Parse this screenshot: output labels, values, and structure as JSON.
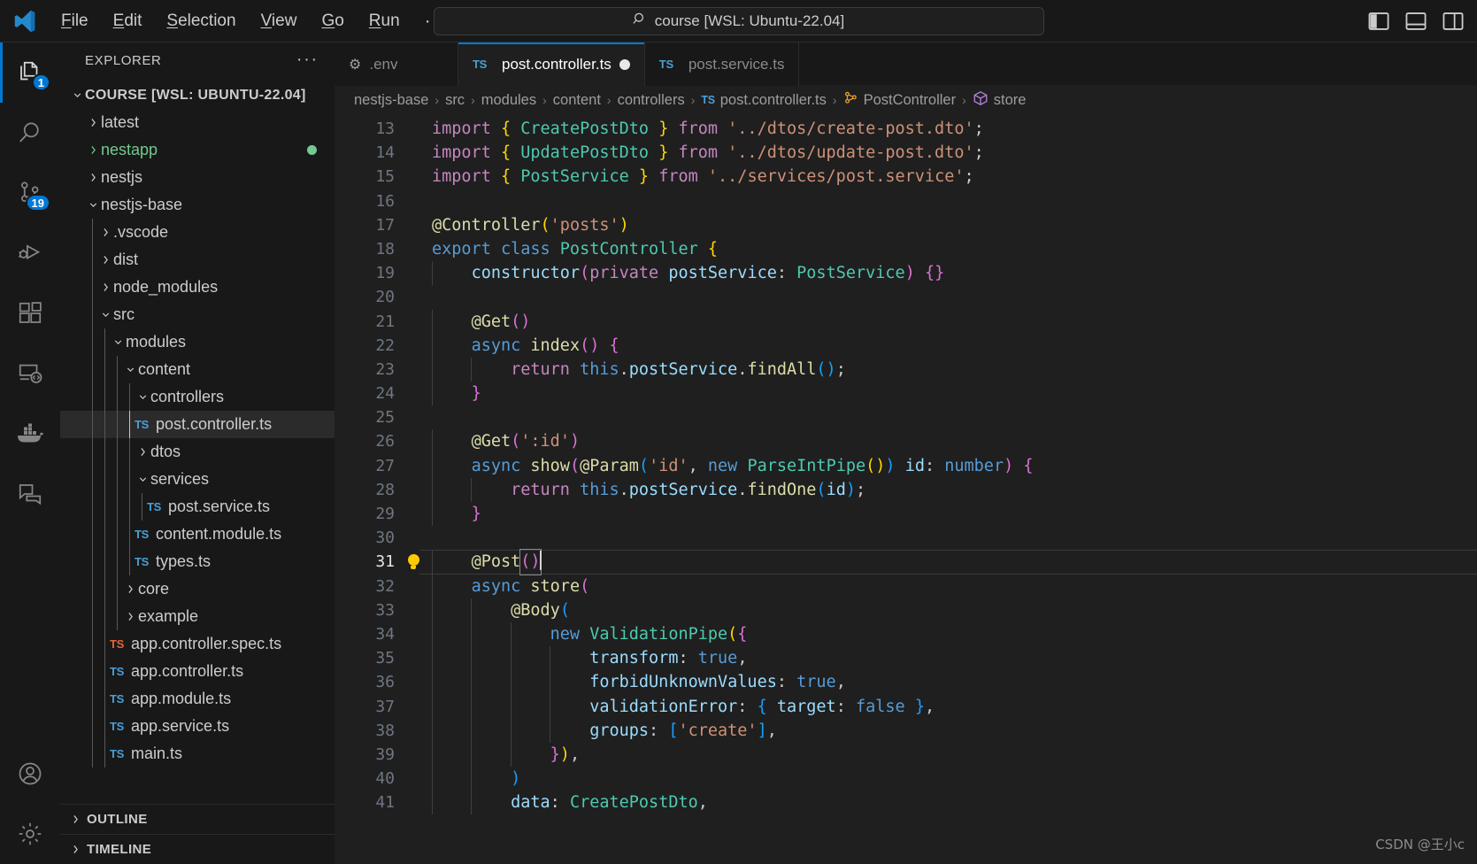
{
  "titlebar": {
    "logo_icon": "vscode-logo-icon",
    "menu": [
      {
        "pre": "",
        "mnemonic": "F",
        "post": "ile",
        "name": "menu-file"
      },
      {
        "pre": "",
        "mnemonic": "E",
        "post": "dit",
        "name": "menu-edit"
      },
      {
        "pre": "",
        "mnemonic": "S",
        "post": "election",
        "name": "menu-selection"
      },
      {
        "pre": "",
        "mnemonic": "V",
        "post": "iew",
        "name": "menu-view"
      },
      {
        "pre": "",
        "mnemonic": "G",
        "post": "o",
        "name": "menu-go"
      },
      {
        "pre": "",
        "mnemonic": "R",
        "post": "un",
        "name": "menu-run"
      }
    ],
    "overflow_label": "···",
    "back_arrow": "←",
    "forward_arrow": "→",
    "command_center": {
      "icon": "search-icon",
      "text": "course [WSL: Ubuntu-22.04]",
      "placeholder": "Search"
    },
    "layout_buttons": [
      {
        "name": "toggle-primary-sidebar-icon",
        "label": "Toggle Primary Side Bar"
      },
      {
        "name": "toggle-panel-icon",
        "label": "Toggle Panel"
      },
      {
        "name": "toggle-secondary-sidebar-icon",
        "label": "Toggle Secondary Side Bar"
      }
    ]
  },
  "activitybar": {
    "items": [
      {
        "name": "activity-explorer",
        "icon": "files-icon",
        "label": "Explorer",
        "badge": "1",
        "active": true
      },
      {
        "name": "activity-search",
        "icon": "search-icon",
        "label": "Search",
        "badge": null,
        "active": false
      },
      {
        "name": "activity-source-control",
        "icon": "source-control-icon",
        "label": "Source Control",
        "badge": "19",
        "active": false
      },
      {
        "name": "activity-run-debug",
        "icon": "run-and-debug-icon",
        "label": "Run and Debug",
        "badge": null,
        "active": false
      },
      {
        "name": "activity-extensions",
        "icon": "extensions-icon",
        "label": "Extensions",
        "badge": null,
        "active": false
      },
      {
        "name": "activity-remote-explorer",
        "icon": "remote-explorer-icon",
        "label": "Remote Explorer",
        "badge": null,
        "active": false
      },
      {
        "name": "activity-docker",
        "icon": "docker-whale-icon",
        "label": "Docker",
        "badge": null,
        "active": false
      },
      {
        "name": "activity-chat",
        "icon": "chat-icon",
        "label": "Chat",
        "badge": null,
        "active": false
      }
    ],
    "bottom": [
      {
        "name": "activity-accounts",
        "icon": "account-icon",
        "label": "Accounts"
      },
      {
        "name": "activity-settings",
        "icon": "gear-icon",
        "label": "Manage"
      }
    ]
  },
  "sidebar": {
    "title": "EXPLORER",
    "more_actions": "···",
    "tree": [
      {
        "label": "COURSE [WSL: UBUNTU-22.04]",
        "depth": 0,
        "type": "root",
        "state": "expanded"
      },
      {
        "label": "latest",
        "depth": 1,
        "type": "folder",
        "state": "collapsed"
      },
      {
        "label": "nestapp",
        "depth": 1,
        "type": "folder",
        "state": "collapsed",
        "git": "untracked",
        "badge_dot": true
      },
      {
        "label": "nestjs",
        "depth": 1,
        "type": "folder",
        "state": "collapsed"
      },
      {
        "label": "nestjs-base",
        "depth": 1,
        "type": "folder",
        "state": "expanded"
      },
      {
        "label": ".vscode",
        "depth": 2,
        "type": "folder",
        "state": "collapsed"
      },
      {
        "label": "dist",
        "depth": 2,
        "type": "folder",
        "state": "collapsed"
      },
      {
        "label": "node_modules",
        "depth": 2,
        "type": "folder",
        "state": "collapsed"
      },
      {
        "label": "src",
        "depth": 2,
        "type": "folder",
        "state": "expanded"
      },
      {
        "label": "modules",
        "depth": 3,
        "type": "folder",
        "state": "expanded"
      },
      {
        "label": "content",
        "depth": 4,
        "type": "folder",
        "state": "expanded"
      },
      {
        "label": "controllers",
        "depth": 5,
        "type": "folder",
        "state": "expanded"
      },
      {
        "label": "post.controller.ts",
        "depth": 6,
        "type": "file",
        "icon": "ts",
        "selected": true
      },
      {
        "label": "dtos",
        "depth": 5,
        "type": "folder",
        "state": "collapsed"
      },
      {
        "label": "services",
        "depth": 5,
        "type": "folder",
        "state": "expanded"
      },
      {
        "label": "post.service.ts",
        "depth": 6,
        "type": "file",
        "icon": "ts"
      },
      {
        "label": "content.module.ts",
        "depth": 5,
        "type": "file",
        "icon": "ts"
      },
      {
        "label": "types.ts",
        "depth": 5,
        "type": "file",
        "icon": "ts"
      },
      {
        "label": "core",
        "depth": 4,
        "type": "folder",
        "state": "collapsed"
      },
      {
        "label": "example",
        "depth": 4,
        "type": "folder",
        "state": "collapsed"
      },
      {
        "label": "app.controller.spec.ts",
        "depth": 3,
        "type": "file",
        "icon": "ts-spec"
      },
      {
        "label": "app.controller.ts",
        "depth": 3,
        "type": "file",
        "icon": "ts"
      },
      {
        "label": "app.module.ts",
        "depth": 3,
        "type": "file",
        "icon": "ts"
      },
      {
        "label": "app.service.ts",
        "depth": 3,
        "type": "file",
        "icon": "ts"
      },
      {
        "label": "main.ts",
        "depth": 3,
        "type": "file",
        "icon": "ts"
      }
    ],
    "sections": [
      {
        "label": "OUTLINE",
        "state": "collapsed",
        "name": "outline-section"
      },
      {
        "label": "TIMELINE",
        "state": "collapsed",
        "name": "timeline-section"
      }
    ]
  },
  "editor": {
    "tabs": [
      {
        "label": ".env",
        "icon": "gear-icon",
        "active": false,
        "dirty": false,
        "name": "tab-env"
      },
      {
        "label": "post.controller.ts",
        "icon": "ts",
        "active": true,
        "dirty": true,
        "name": "tab-post-controller"
      },
      {
        "label": "post.service.ts",
        "icon": "ts",
        "active": false,
        "dirty": false,
        "name": "tab-post-service"
      }
    ],
    "breadcrumb": [
      {
        "label": "nestjs-base",
        "icon": null
      },
      {
        "label": "src",
        "icon": null
      },
      {
        "label": "modules",
        "icon": null
      },
      {
        "label": "content",
        "icon": null
      },
      {
        "label": "controllers",
        "icon": null
      },
      {
        "label": "post.controller.ts",
        "icon": "ts"
      },
      {
        "label": "PostController",
        "icon": "class-symbol-icon"
      },
      {
        "label": "store",
        "icon": "method-symbol-icon"
      }
    ],
    "separator": "›",
    "current_line": 31,
    "lightbulb_line": 31,
    "first_visible_line": 13,
    "watermark": "CSDN @王小c",
    "code": [
      {
        "n": 13,
        "tokens": [
          [
            "ctl",
            "import "
          ],
          [
            "b1",
            "{"
          ],
          [
            "plain",
            " "
          ],
          [
            "cls",
            "CreatePostDto"
          ],
          [
            "plain",
            " "
          ],
          [
            "b1",
            "}"
          ],
          [
            "ctl",
            " from "
          ],
          [
            "str",
            "'../dtos/create-post.dto'"
          ],
          [
            "plain",
            ";"
          ]
        ]
      },
      {
        "n": 14,
        "tokens": [
          [
            "ctl",
            "import "
          ],
          [
            "b1",
            "{"
          ],
          [
            "plain",
            " "
          ],
          [
            "cls",
            "UpdatePostDto"
          ],
          [
            "plain",
            " "
          ],
          [
            "b1",
            "}"
          ],
          [
            "ctl",
            " from "
          ],
          [
            "str",
            "'../dtos/update-post.dto'"
          ],
          [
            "plain",
            ";"
          ]
        ]
      },
      {
        "n": 15,
        "tokens": [
          [
            "ctl",
            "import "
          ],
          [
            "b1",
            "{"
          ],
          [
            "plain",
            " "
          ],
          [
            "cls",
            "PostService"
          ],
          [
            "plain",
            " "
          ],
          [
            "b1",
            "}"
          ],
          [
            "ctl",
            " from "
          ],
          [
            "str",
            "'../services/post.service'"
          ],
          [
            "plain",
            ";"
          ]
        ]
      },
      {
        "n": 16,
        "tokens": []
      },
      {
        "n": 17,
        "tokens": [
          [
            "fn",
            "@Controller"
          ],
          [
            "b1",
            "("
          ],
          [
            "str",
            "'posts'"
          ],
          [
            "b1",
            ")"
          ]
        ]
      },
      {
        "n": 18,
        "tokens": [
          [
            "kw",
            "export "
          ],
          [
            "kw",
            "class "
          ],
          [
            "cls",
            "PostController"
          ],
          [
            "plain",
            " "
          ],
          [
            "b1",
            "{"
          ]
        ]
      },
      {
        "n": 19,
        "tokens": [
          [
            "plain",
            "    "
          ],
          [
            "var",
            "constructor"
          ],
          [
            "b2",
            "("
          ],
          [
            "ctl",
            "private "
          ],
          [
            "var",
            "postService"
          ],
          [
            "plain",
            ": "
          ],
          [
            "cls",
            "PostService"
          ],
          [
            "b2",
            ")"
          ],
          [
            "plain",
            " "
          ],
          [
            "b2",
            "{}"
          ]
        ]
      },
      {
        "n": 20,
        "tokens": []
      },
      {
        "n": 21,
        "tokens": [
          [
            "plain",
            "    "
          ],
          [
            "fn",
            "@Get"
          ],
          [
            "b2",
            "()"
          ]
        ]
      },
      {
        "n": 22,
        "tokens": [
          [
            "plain",
            "    "
          ],
          [
            "kw",
            "async "
          ],
          [
            "fn",
            "index"
          ],
          [
            "b2",
            "()"
          ],
          [
            "plain",
            " "
          ],
          [
            "b2",
            "{"
          ]
        ]
      },
      {
        "n": 23,
        "tokens": [
          [
            "plain",
            "        "
          ],
          [
            "ctl",
            "return "
          ],
          [
            "kw",
            "this"
          ],
          [
            "plain",
            "."
          ],
          [
            "var",
            "postService"
          ],
          [
            "plain",
            "."
          ],
          [
            "fn",
            "findAll"
          ],
          [
            "b3",
            "()"
          ],
          [
            "plain",
            ";"
          ]
        ]
      },
      {
        "n": 24,
        "tokens": [
          [
            "plain",
            "    "
          ],
          [
            "b2",
            "}"
          ]
        ]
      },
      {
        "n": 25,
        "tokens": []
      },
      {
        "n": 26,
        "tokens": [
          [
            "plain",
            "    "
          ],
          [
            "fn",
            "@Get"
          ],
          [
            "b2",
            "("
          ],
          [
            "str",
            "':id'"
          ],
          [
            "b2",
            ")"
          ]
        ]
      },
      {
        "n": 27,
        "tokens": [
          [
            "plain",
            "    "
          ],
          [
            "kw",
            "async "
          ],
          [
            "fn",
            "show"
          ],
          [
            "b2",
            "("
          ],
          [
            "fn",
            "@Param"
          ],
          [
            "b3",
            "("
          ],
          [
            "str",
            "'id'"
          ],
          [
            "plain",
            ", "
          ],
          [
            "kw",
            "new "
          ],
          [
            "cls",
            "ParseIntPipe"
          ],
          [
            "b1",
            "()"
          ],
          [
            "b3",
            ")"
          ],
          [
            "plain",
            " "
          ],
          [
            "var",
            "id"
          ],
          [
            "plain",
            ": "
          ],
          [
            "kw",
            "number"
          ],
          [
            "b2",
            ")"
          ],
          [
            "plain",
            " "
          ],
          [
            "b2",
            "{"
          ]
        ]
      },
      {
        "n": 28,
        "tokens": [
          [
            "plain",
            "        "
          ],
          [
            "ctl",
            "return "
          ],
          [
            "kw",
            "this"
          ],
          [
            "plain",
            "."
          ],
          [
            "var",
            "postService"
          ],
          [
            "plain",
            "."
          ],
          [
            "fn",
            "findOne"
          ],
          [
            "b3",
            "("
          ],
          [
            "var",
            "id"
          ],
          [
            "b3",
            ")"
          ],
          [
            "plain",
            ";"
          ]
        ]
      },
      {
        "n": 29,
        "tokens": [
          [
            "plain",
            "    "
          ],
          [
            "b2",
            "}"
          ]
        ]
      },
      {
        "n": 30,
        "tokens": []
      },
      {
        "n": 31,
        "tokens": [
          [
            "plain",
            "    "
          ],
          [
            "fn",
            "@Post"
          ]
        ],
        "cursor_after_brackets": "()"
      },
      {
        "n": 32,
        "tokens": [
          [
            "plain",
            "    "
          ],
          [
            "kw",
            "async "
          ],
          [
            "fn",
            "store"
          ],
          [
            "b2",
            "("
          ]
        ]
      },
      {
        "n": 33,
        "tokens": [
          [
            "plain",
            "        "
          ],
          [
            "fn",
            "@Body"
          ],
          [
            "b3",
            "("
          ]
        ]
      },
      {
        "n": 34,
        "tokens": [
          [
            "plain",
            "            "
          ],
          [
            "kw",
            "new "
          ],
          [
            "cls",
            "ValidationPipe"
          ],
          [
            "b1",
            "("
          ],
          [
            "b2",
            "{"
          ]
        ]
      },
      {
        "n": 35,
        "tokens": [
          [
            "plain",
            "                "
          ],
          [
            "var",
            "transform"
          ],
          [
            "plain",
            ": "
          ],
          [
            "kw",
            "true"
          ],
          [
            "plain",
            ","
          ]
        ]
      },
      {
        "n": 36,
        "tokens": [
          [
            "plain",
            "                "
          ],
          [
            "var",
            "forbidUnknownValues"
          ],
          [
            "plain",
            ": "
          ],
          [
            "kw",
            "true"
          ],
          [
            "plain",
            ","
          ]
        ]
      },
      {
        "n": 37,
        "tokens": [
          [
            "plain",
            "                "
          ],
          [
            "var",
            "validationError"
          ],
          [
            "plain",
            ": "
          ],
          [
            "b3",
            "{"
          ],
          [
            "plain",
            " "
          ],
          [
            "var",
            "target"
          ],
          [
            "plain",
            ": "
          ],
          [
            "kw",
            "false"
          ],
          [
            "plain",
            " "
          ],
          [
            "b3",
            "}"
          ],
          [
            "plain",
            ","
          ]
        ]
      },
      {
        "n": 38,
        "tokens": [
          [
            "plain",
            "                "
          ],
          [
            "var",
            "groups"
          ],
          [
            "plain",
            ": "
          ],
          [
            "b3",
            "["
          ],
          [
            "str",
            "'create'"
          ],
          [
            "b3",
            "]"
          ],
          [
            "plain",
            ","
          ]
        ]
      },
      {
        "n": 39,
        "tokens": [
          [
            "plain",
            "            "
          ],
          [
            "b2",
            "}"
          ],
          [
            "b1",
            ")"
          ],
          [
            "plain",
            ","
          ]
        ]
      },
      {
        "n": 40,
        "tokens": [
          [
            "plain",
            "        "
          ],
          [
            "b3",
            ")"
          ]
        ]
      },
      {
        "n": 41,
        "tokens": [
          [
            "plain",
            "        "
          ],
          [
            "var",
            "data"
          ],
          [
            "plain",
            ": "
          ],
          [
            "cls",
            "CreatePostDto"
          ],
          [
            "plain",
            ","
          ]
        ]
      }
    ]
  },
  "colors": {
    "accent": "#0078d4",
    "badge_bg": "#0078d4",
    "git_untracked": "#73c991",
    "editor_bg": "#1f1f1f",
    "sidebar_bg": "#181818",
    "lightbulb": "#ffcc00"
  }
}
